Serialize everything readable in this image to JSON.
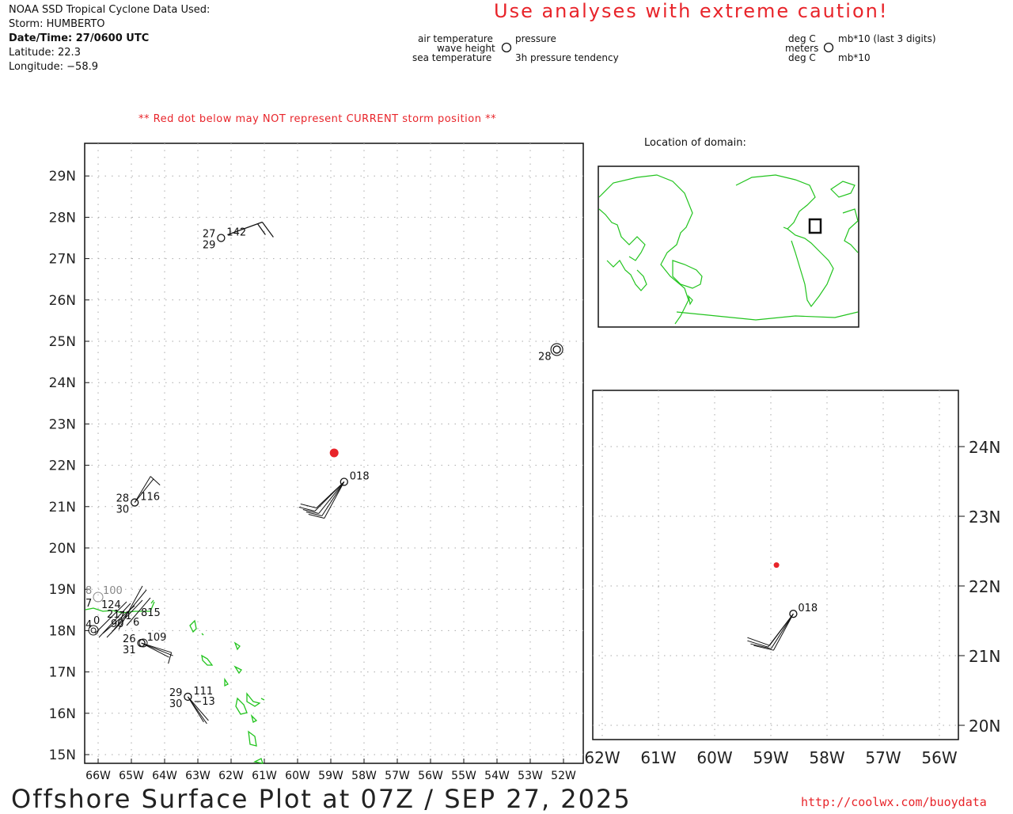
{
  "header": {
    "source": "NOAA SSD Tropical Cyclone Data Used:",
    "storm": "Storm: HUMBERTO",
    "datetime": "Date/Time: 27/0600 UTC",
    "latitude": "Latitude: 22.3",
    "longitude": "Longitude: −58.9",
    "caution": "Use analyses with extreme caution!",
    "red_dot_warning": "** Red dot below may NOT represent CURRENT storm position **"
  },
  "legend": {
    "air_temperature": "air temperature",
    "pressure": "pressure",
    "wave_height": "wave height",
    "sea_temperature": "sea temperature",
    "pressure_tendency": "3h pressure tendency",
    "unit_deg_c_1": "deg C",
    "unit_mb10_last3": "mb*10 (last 3 digits)",
    "unit_meters": "meters",
    "unit_deg_c_2": "deg C",
    "unit_mb10": "mb*10"
  },
  "location_label": "Location of domain:",
  "footer": {
    "title": "Offshore Surface Plot at 07Z / SEP 27, 2025",
    "url": "http://coolwx.com/buoydata"
  },
  "colors": {
    "text_red": "#e8242a",
    "land": "#22c41e",
    "storm_dot": "#e8242a",
    "grid": "#aaaaaa"
  },
  "main_map": {
    "lon_ticks": [
      "66W",
      "65W",
      "64W",
      "63W",
      "62W",
      "61W",
      "60W",
      "59W",
      "58W",
      "57W",
      "56W",
      "55W",
      "54W",
      "53W",
      "52W"
    ],
    "lat_ticks": [
      "15N",
      "16N",
      "17N",
      "18N",
      "19N",
      "20N",
      "21N",
      "22N",
      "23N",
      "24N",
      "25N",
      "26N",
      "27N",
      "28N",
      "29N"
    ],
    "storm_position": {
      "lat": 22.3,
      "lon": -58.9
    },
    "stations": [
      {
        "lat": 21.6,
        "lon": -58.6,
        "pressure": "018",
        "air_temp": "",
        "sea_temp": ""
      },
      {
        "lat": 27.5,
        "lon": -62.3,
        "pressure": "142",
        "air_temp": "27",
        "sea_temp": "29"
      },
      {
        "lat": 21.1,
        "lon": -64.9,
        "pressure": "116",
        "air_temp": "28",
        "sea_temp": "30"
      },
      {
        "lat": 16.4,
        "lon": -63.3,
        "pressure": "111",
        "air_temp": "29",
        "sea_temp": "30",
        "tendency": "−13"
      },
      {
        "lat": 17.7,
        "lon": -64.7,
        "pressure": "109",
        "air_temp": "26",
        "sea_temp": "31"
      },
      {
        "lat": 24.8,
        "lon": -52.2,
        "pressure": "",
        "air_temp": "",
        "sea_temp": "28"
      }
    ]
  },
  "inset_map": {
    "lon_ticks": [
      "62W",
      "61W",
      "60W",
      "59W",
      "58W",
      "57W",
      "56W"
    ],
    "lat_ticks": [
      "20N",
      "21N",
      "22N",
      "23N",
      "24N"
    ],
    "stations": [
      {
        "lat": 21.6,
        "lon": -58.6,
        "pressure": "018"
      }
    ]
  }
}
